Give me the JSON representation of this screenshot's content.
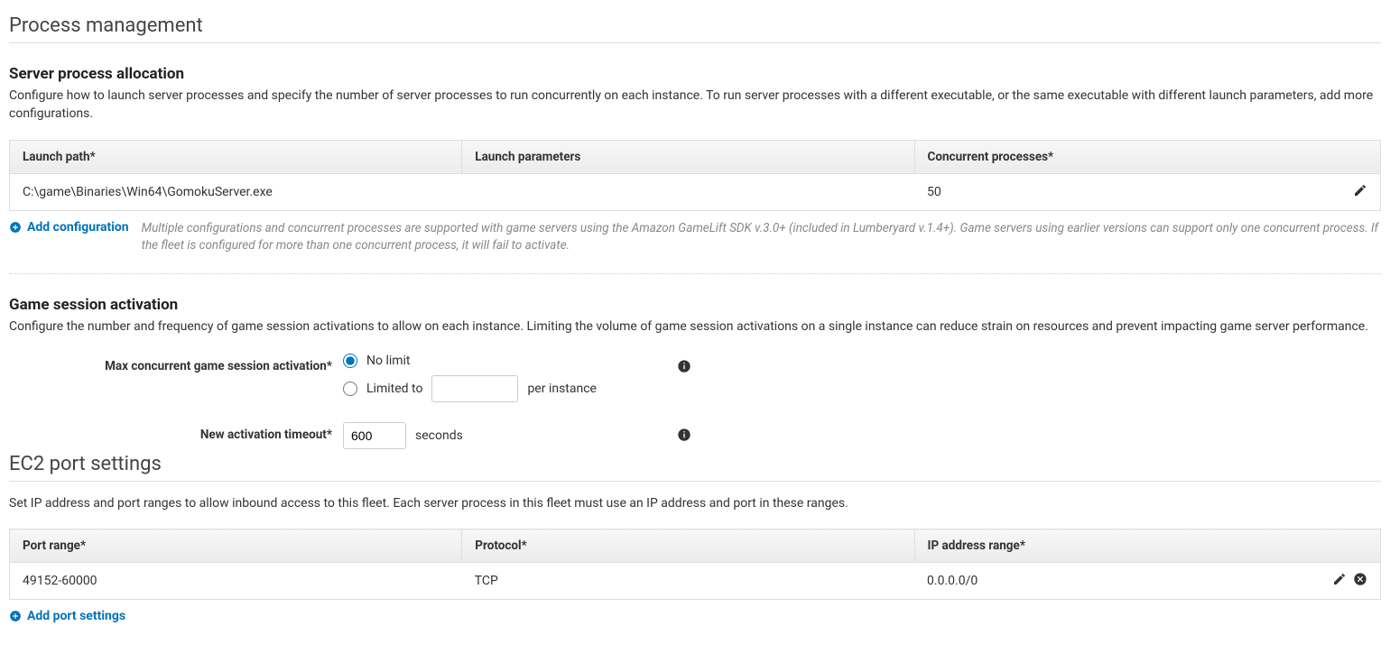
{
  "process_mgmt": {
    "title": "Process management",
    "server_alloc": {
      "title": "Server process allocation",
      "desc": "Configure how to launch server processes and specify the number of server processes to run concurrently on each instance. To run server processes with a different executable, or the same executable with different launch parameters, add more configurations.",
      "headers": {
        "launch_path": "Launch path*",
        "launch_params": "Launch parameters",
        "concurrent": "Concurrent processes*"
      },
      "rows": [
        {
          "launch_path": "C:\\game\\Binaries\\Win64\\GomokuServer.exe",
          "launch_params": "",
          "concurrent": "50"
        }
      ],
      "add_label": "Add configuration",
      "note": "Multiple configurations and concurrent processes are supported with game servers using the Amazon GameLift SDK v.3.0+ (included in Lumberyard v.1.4+). Game servers using earlier versions can support only one concurrent process. If the fleet is configured for more than one concurrent process, it will fail to activate."
    },
    "session_activation": {
      "title": "Game session activation",
      "desc": "Configure the number and frequency of game session activations to allow on each instance. Limiting the volume of game session activations on a single instance can reduce strain on resources and prevent impacting game server performance.",
      "max_label": "Max concurrent game session activation*",
      "no_limit": "No limit",
      "limited_to": "Limited to",
      "per_instance": "per instance",
      "limited_value": "",
      "timeout_label": "New activation timeout*",
      "timeout_value": "600",
      "seconds": "seconds"
    }
  },
  "ec2": {
    "title": "EC2 port settings",
    "desc": "Set IP address and port ranges to allow inbound access to this fleet. Each server process in this fleet must use an IP address and port in these ranges.",
    "headers": {
      "port_range": "Port range*",
      "protocol": "Protocol*",
      "ip_range": "IP address range*"
    },
    "rows": [
      {
        "port_range": "49152-60000",
        "protocol": "TCP",
        "ip_range": "0.0.0.0/0"
      }
    ],
    "add_label": "Add port settings"
  }
}
